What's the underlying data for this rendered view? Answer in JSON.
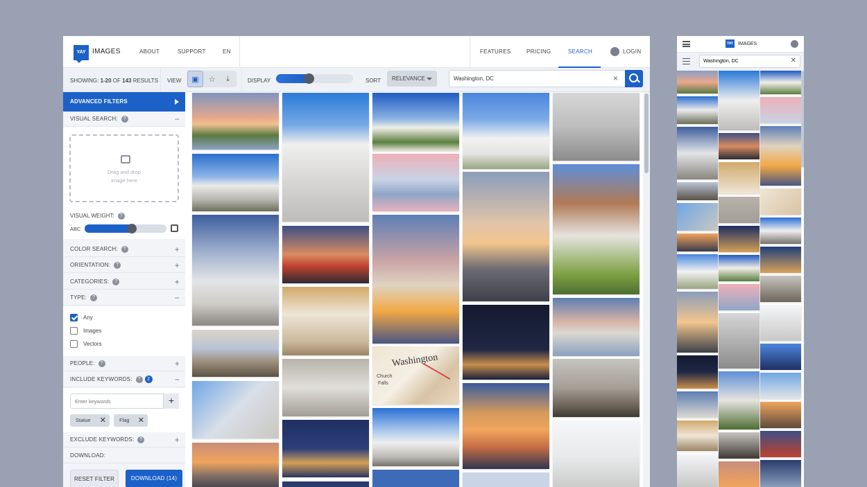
{
  "nav": {
    "logo_text": "YAY",
    "brand": "IMAGES",
    "about": "ABOUT",
    "support": "SUPPORT",
    "lang": "EN",
    "features": "FEATURES",
    "pricing": "PRICING",
    "search": "SEARCH",
    "login": "LOGIN"
  },
  "toolbar": {
    "showing_prefix": "SHOWING: ",
    "showing_range": "1-20",
    "showing_of": " OF ",
    "showing_total": "143",
    "showing_suffix": " RESULTS",
    "view_label": "VIEW",
    "display_label": "DISPLAY",
    "display_level": 0.42,
    "sort_label": "SORT",
    "sort_value": "RELEVANCE",
    "search_value": "Washington, DC"
  },
  "sidebar": {
    "advanced": "ADVANCED FILTERS",
    "visual_search": "VISUAL SEARCH:",
    "drop_line1": "Drag and drop",
    "drop_line2": "image here",
    "visual_weight": "VISUAL WEIGHT:",
    "weight_abc": "ABC",
    "weight_level": 0.58,
    "color_search": "COLOR SEARCH:",
    "orientation": "ORIENTATION:",
    "categories": "CATEGORIES:",
    "type": "TYPE:",
    "type_options": [
      "Any",
      "Images",
      "Vectors"
    ],
    "people": "PEOPLE:",
    "include_keywords": "INCLUDE KEYWORDS:",
    "include_count": "2",
    "keyword_placeholder": "Enter keywords",
    "tags": [
      "Statue",
      "Flag"
    ],
    "exclude_keywords": "EXCLUDE KEYWORDS:",
    "download": "DOWNLOAD:",
    "reset": "RESET FILTER",
    "download_btn": "DOWNLOAD (14)"
  },
  "map_text": {
    "title": "Washington",
    "line2": "Church",
    "line3": "Falls"
  },
  "mobile": {
    "logo_text": "YAY",
    "brand": "IMAGES",
    "search_value": "Washington, DC"
  },
  "colors": {
    "accent": "#1b61c8",
    "background": "#99a1b3"
  }
}
